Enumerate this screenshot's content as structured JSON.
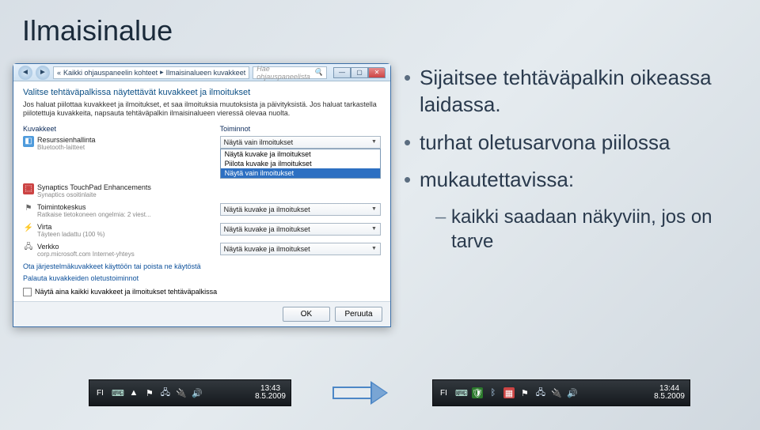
{
  "slide": {
    "title": "Ilmaisinalue",
    "bullet1": "Sijaitsee tehtäväpalkin oikeassa laidassa.",
    "bullet2": "turhat oletusarvona piilossa",
    "bullet3": "mukautettavissa:",
    "sub1": "kaikki saadaan näkyviin, jos on tarve"
  },
  "window": {
    "breadcrumb": {
      "chevrons": "«",
      "part1": "Kaikki ohjauspaneelin kohteet",
      "sep": "▸",
      "part2": "Ilmaisinalueen kuvakkeet"
    },
    "search_placeholder": "Hae ohjauspaneelista",
    "heading": "Valitse tehtäväpalkissa näytettävät kuvakkeet ja ilmoitukset",
    "desc": "Jos haluat piilottaa kuvakkeet ja ilmoitukset, et saa ilmoituksia muutoksista ja päivityksistä. Jos haluat tarkastella piilotettuja kuvakkeita, napsauta tehtäväpalkin ilmaisinalueen vieressä olevaa nuolta.",
    "cols": {
      "left": "Kuvakkeet",
      "right": "Toiminnot"
    },
    "rows": [
      {
        "name": "Resurssienhallinta",
        "sub": "Bluetooth-laitteet",
        "icon": "ic-blue",
        "glyph": "◧",
        "action_type": "dropdown",
        "selected": "Näytä vain ilmoitukset",
        "options": [
          "Näytä kuvake ja ilmoitukset",
          "Piilota kuvake ja ilmoitukset",
          "Näytä vain ilmoitukset"
        ]
      },
      {
        "name": "Synaptics TouchPad Enhancements",
        "sub": "Synaptics osoitinlaite",
        "icon": "ic-red",
        "glyph": "⬚",
        "action_type": "none"
      },
      {
        "name": "Toimintokeskus",
        "sub": "Ratkaise tietokoneen ongelmia: 2 viest...",
        "icon": "ic-flag",
        "glyph": "⚑",
        "action_type": "combo",
        "value": "Näytä kuvake ja ilmoitukset"
      },
      {
        "name": "Virta",
        "sub": "Täyteen ladattu (100 %)",
        "icon": "ic-plug",
        "glyph": "⚡",
        "action_type": "combo",
        "value": "Näytä kuvake ja ilmoitukset"
      },
      {
        "name": "Verkko",
        "sub": "corp.microsoft.com Internet-yhteys",
        "icon": "ic-net",
        "glyph": "🖧",
        "action_type": "combo",
        "value": "Näytä kuvake ja ilmoitukset"
      }
    ],
    "link1": "Ota järjestelmäkuvakkeet käyttöön tai poista ne käytöstä",
    "link2": "Palauta kuvakkeiden oletustoiminnot",
    "checkbox": "Näytä aina kaikki kuvakkeet ja ilmoitukset tehtäväpalkissa",
    "ok": "OK",
    "cancel": "Peruuta"
  },
  "tray1": {
    "lang": "FI",
    "time": "13:43",
    "date": "8.5.2009"
  },
  "tray2": {
    "lang": "FI",
    "time": "13:44",
    "date": "8.5.2009"
  }
}
